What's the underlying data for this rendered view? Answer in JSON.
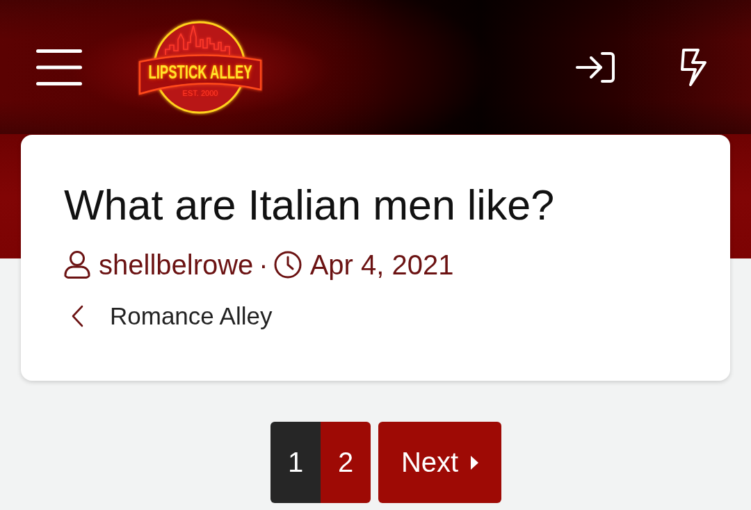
{
  "header": {
    "logo": {
      "title": "LIPSTICK ALLEY",
      "tagline": "EST. 2000"
    }
  },
  "thread": {
    "title": "What are Italian men like?",
    "author": "shellbelrowe",
    "separator": "·",
    "date": "Apr 4, 2021",
    "breadcrumb": "Romance Alley"
  },
  "pagination": {
    "pages": [
      {
        "label": "1",
        "selected": true
      },
      {
        "label": "2",
        "selected": false
      }
    ],
    "next": "Next"
  }
}
